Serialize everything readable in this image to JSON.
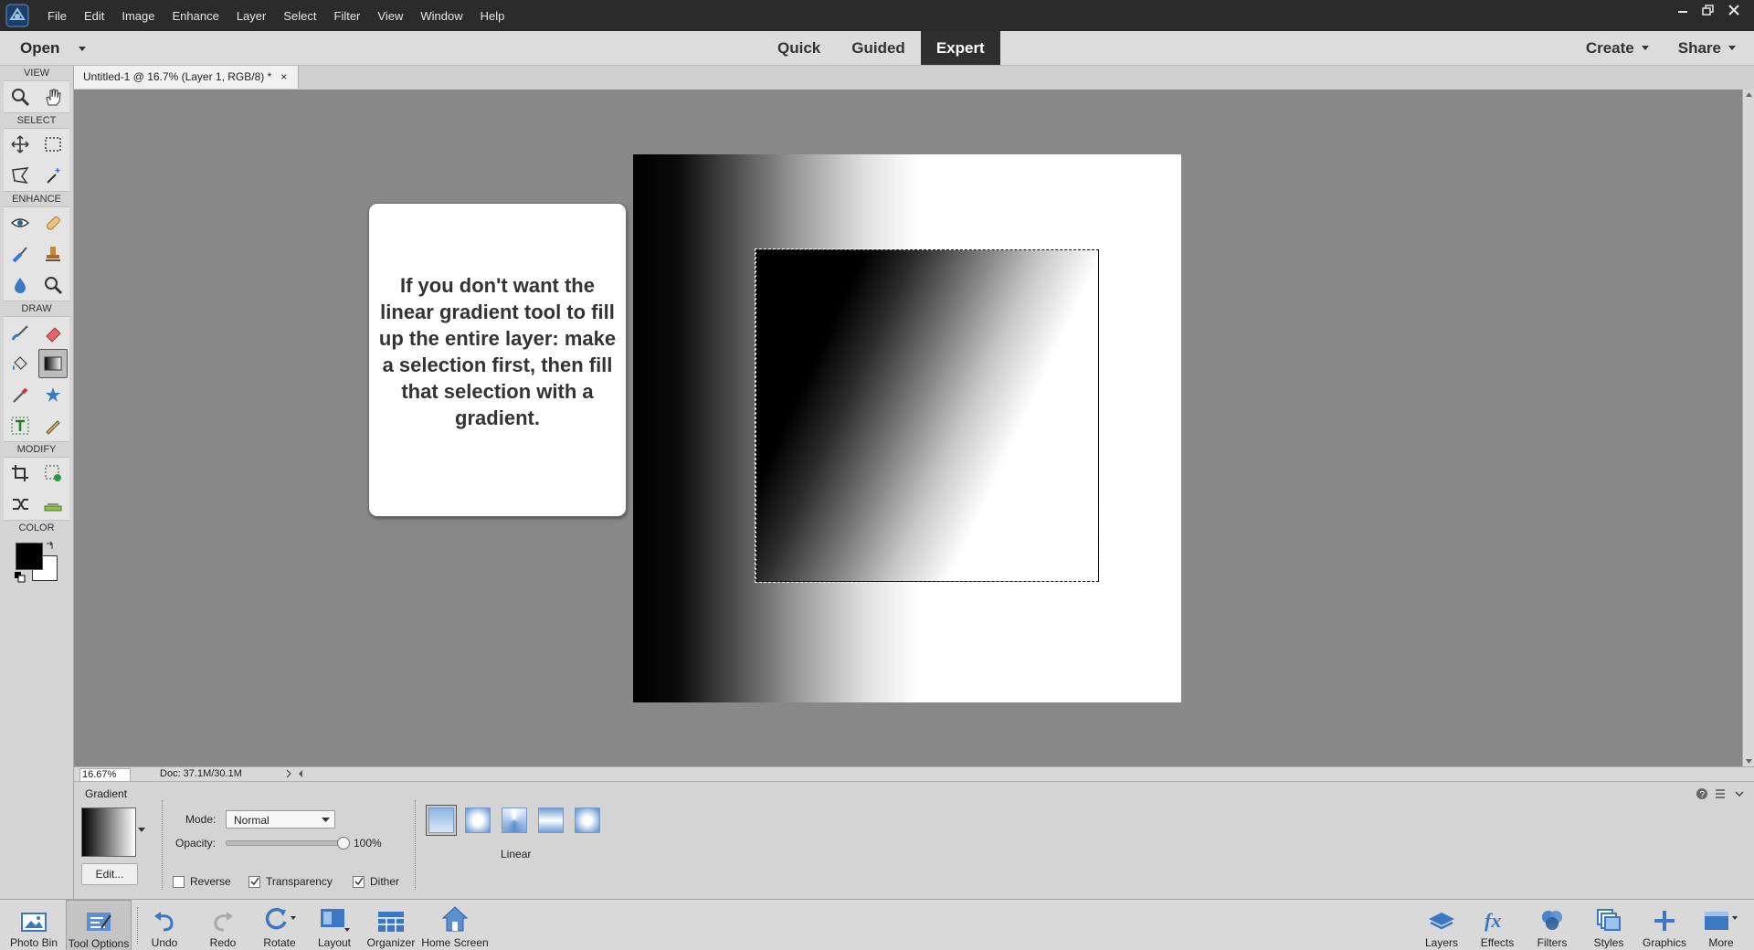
{
  "menubar": {
    "items": [
      "File",
      "Edit",
      "Image",
      "Enhance",
      "Layer",
      "Select",
      "Filter",
      "View",
      "Window",
      "Help"
    ]
  },
  "modebar": {
    "open_label": "Open",
    "modes": [
      "Quick",
      "Guided",
      "Expert"
    ],
    "active_mode": "Expert",
    "create_label": "Create",
    "share_label": "Share"
  },
  "toolbox": {
    "sections": {
      "view": "VIEW",
      "select": "SELECT",
      "enhance": "ENHANCE",
      "draw": "DRAW",
      "modify": "MODIFY",
      "color": "COLOR"
    },
    "active_tool": "gradient-tool",
    "foreground_color": "#000000",
    "background_color": "#ffffff"
  },
  "document": {
    "tab_title": "Untitled-1 @ 16.7% (Layer 1, RGB/8) *",
    "close_glyph": "×"
  },
  "callout": {
    "text": "If you don't want the linear gradient tool to fill up the entire layer: make a selection first, then fill that selection with a gradient."
  },
  "statusbar": {
    "zoom": "16.67%",
    "doc_info": "Doc: 37.1M/30.1M"
  },
  "tool_options": {
    "title": "Gradient",
    "edit_label": "Edit...",
    "mode_label": "Mode:",
    "mode_value": "Normal",
    "opacity_label": "Opacity:",
    "opacity_value": "100%",
    "opacity_level": 1.0,
    "reverse_label": "Reverse",
    "reverse_checked": false,
    "transparency_label": "Transparency",
    "transparency_checked": true,
    "dither_label": "Dither",
    "dither_checked": true,
    "gradient_types": [
      "linear",
      "radial",
      "angle",
      "reflected",
      "diamond"
    ],
    "selected_type_label": "Linear"
  },
  "taskbar": {
    "left": [
      "Photo Bin",
      "Tool Options",
      "Undo",
      "Redo",
      "Rotate",
      "Layout",
      "Organizer",
      "Home Screen"
    ],
    "right": [
      "Layers",
      "Effects",
      "Filters",
      "Styles",
      "Graphics",
      "More"
    ],
    "active": "Tool Options"
  },
  "colors": {
    "menubar_bg": "#2b2b2b",
    "canvas_bg": "#888888",
    "accent_blue": "#3b78c3"
  }
}
